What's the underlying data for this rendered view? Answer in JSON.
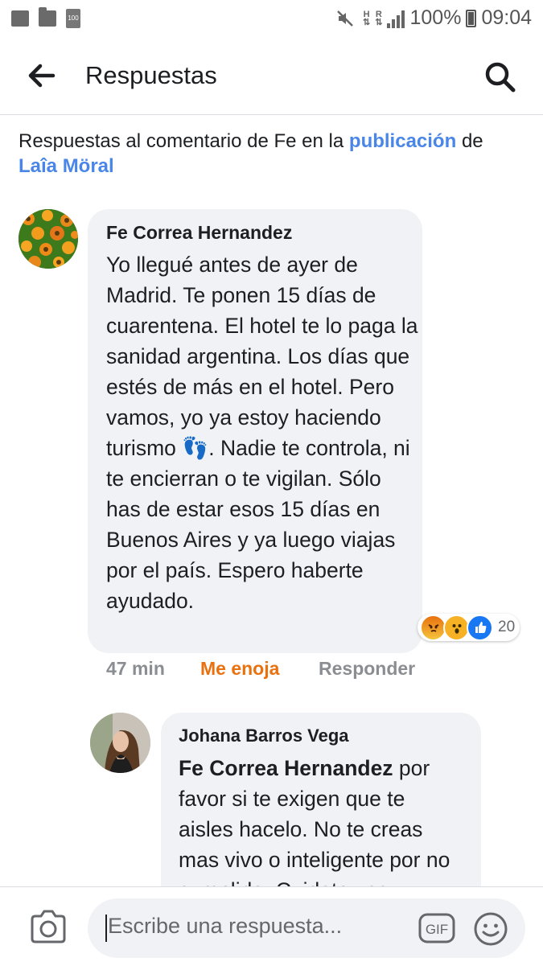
{
  "status_bar": {
    "battery": "100%",
    "time": "09:04",
    "net_label_1": "H",
    "net_label_2": "R"
  },
  "header": {
    "title": "Respuestas"
  },
  "context": {
    "prefix": "Respuestas al comentario de Fe en la",
    "link1": "publicación",
    "middle": "de",
    "link2": "Laîa Möral"
  },
  "comments": [
    {
      "author": "Fe Correa Hernandez",
      "text": "Yo llegué antes de ayer de Madrid. Te ponen 15 días de cuarentena. El hotel te lo paga la sanidad argentina. Los días que estés de más en el hotel. Pero vamos, yo ya estoy haciendo turismo",
      "emoji": "👣",
      "text_after": ". Nadie te controla, ni te encierran o te vigilan. Sólo has de estar esos 15 días en Buenos Aires y ya luego viajas por el país. Espero haberte ayudado.",
      "reaction_icons": [
        "angry-reaction",
        "wow-reaction",
        "like-reaction"
      ],
      "reaction_count": "20",
      "time": "47 min",
      "my_reaction": "Me enoja",
      "reply_label": "Responder"
    },
    {
      "author": "Johana Barros Vega",
      "mention": "Fe Correa Hernandez",
      "text": " por favor si te exigen que te aisles hacelo. No te creas mas vivo o inteligente por no cumplirlo. Cuidate vos"
    }
  ],
  "composer": {
    "placeholder": "Escribe una respuesta...",
    "gif_label": "GIF"
  },
  "colors": {
    "link": "#4a86e8",
    "angry": "#e9710f",
    "bubble": "#f0f2f5",
    "muted": "#8a8d91"
  }
}
